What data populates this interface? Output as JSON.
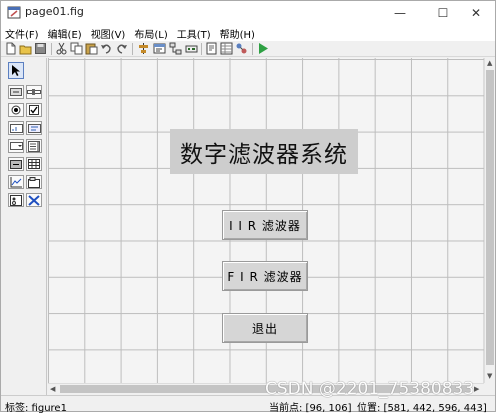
{
  "window": {
    "title": "page01.fig",
    "controls": {
      "minimize": "—",
      "maximize": "☐",
      "close": "✕"
    }
  },
  "menu": [
    "文件(F)",
    "编辑(E)",
    "视图(V)",
    "布局(L)",
    "工具(T)",
    "帮助(H)"
  ],
  "toolbar": {
    "icons": [
      "new-file-icon",
      "open-file-icon",
      "save-icon",
      "cut-icon",
      "copy-icon",
      "paste-icon",
      "undo-icon",
      "redo-icon",
      "align-icon",
      "menu-editor-icon",
      "tab-order-icon",
      "toolbar-editor-icon",
      "mfile-editor-icon",
      "property-inspector-icon",
      "object-browser-icon",
      "run-icon"
    ]
  },
  "palette": {
    "tools": [
      "select-tool",
      "push-button-tool",
      "slider-tool",
      "radio-button-tool",
      "checkbox-tool",
      "edit-text-tool",
      "static-text-tool",
      "popup-menu-tool",
      "listbox-tool",
      "toggle-button-tool",
      "table-tool",
      "axes-tool",
      "panel-tool",
      "button-group-tool",
      "activex-tool"
    ]
  },
  "figure": {
    "title": "数字滤波器系统",
    "buttons": [
      {
        "label": "I I R 滤波器"
      },
      {
        "label": "F I R 滤波器"
      },
      {
        "label": "退出"
      }
    ]
  },
  "status": {
    "tag": "标签: figure1",
    "current_point": "当前点:  [96, 106]",
    "position": "位置:  [581, 442, 596, 443]"
  },
  "watermark": "CSDN @2201_75380833"
}
